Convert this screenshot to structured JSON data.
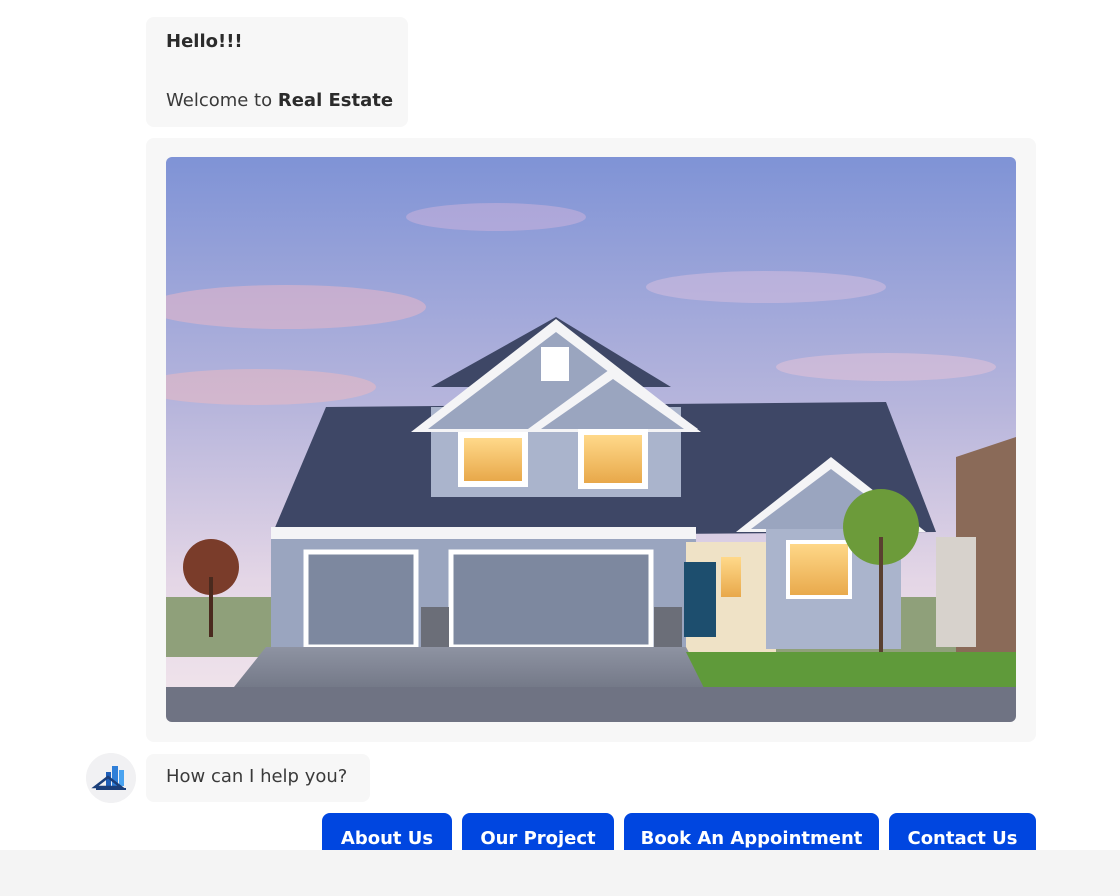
{
  "messages": {
    "greeting": {
      "hello": "Hello!!!",
      "welcome_prefix": "Welcome to ",
      "welcome_brand": "Real Estate"
    },
    "image_alt": "house photo",
    "question": "How can I help you?"
  },
  "avatar_icon": "building-logo-icon",
  "quick_replies": [
    "About Us",
    "Our Project",
    "Book An Appointment",
    "Contact Us"
  ],
  "colors": {
    "accent": "#0046e0",
    "bubble": "#f7f7f7",
    "footer": "#f4f4f4"
  }
}
